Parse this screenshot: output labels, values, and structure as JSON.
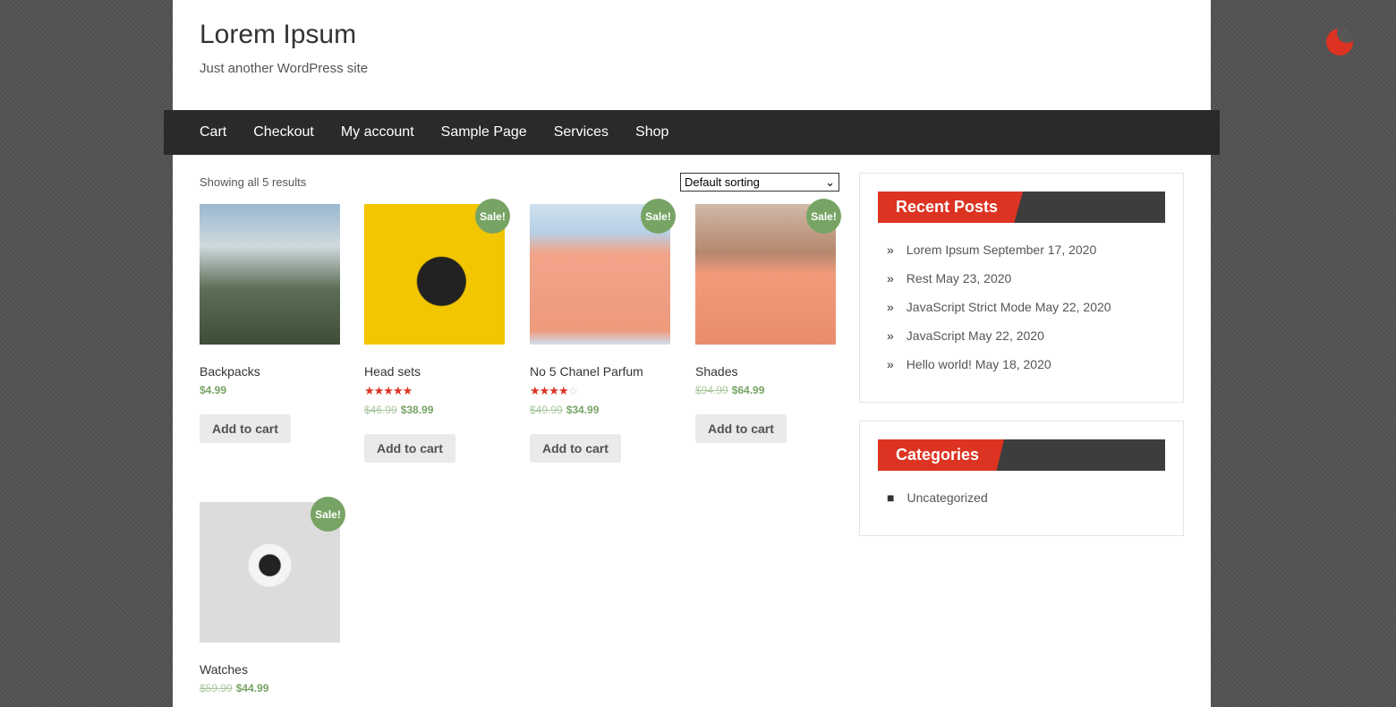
{
  "site": {
    "title": "Lorem Ipsum",
    "tagline": "Just another WordPress site"
  },
  "nav": [
    "Cart",
    "Checkout",
    "My account",
    "Sample Page",
    "Services",
    "Shop"
  ],
  "shop": {
    "result_count": "Showing all 5 results",
    "sorting": "Default sorting"
  },
  "products": [
    {
      "name": "Backpacks",
      "price": "$4.99",
      "old_price": "",
      "sale": "",
      "rating": null,
      "button": "Add to cart"
    },
    {
      "name": "Head sets",
      "price": "$38.99",
      "old_price": "$46.99",
      "sale": "Sale!",
      "rating": 5,
      "button": "Add to cart"
    },
    {
      "name": "No 5 Chanel Parfum",
      "price": "$34.99",
      "old_price": "$49.99",
      "sale": "Sale!",
      "rating": 4,
      "button": "Add to cart"
    },
    {
      "name": "Shades",
      "price": "$64.99",
      "old_price": "$94.99",
      "sale": "Sale!",
      "rating": null,
      "button": "Add to cart"
    },
    {
      "name": "Watches",
      "price": "$44.99",
      "old_price": "$59.99",
      "sale": "Sale!",
      "rating": null,
      "button": ""
    }
  ],
  "sidebar": {
    "recent_posts": {
      "title": "Recent Posts",
      "items": [
        "Lorem Ipsum September 17, 2020",
        "Rest May 23, 2020",
        "JavaScript Strict Mode May 22, 2020",
        "JavaScript May 22, 2020",
        "Hello world! May 18, 2020"
      ]
    },
    "categories": {
      "title": "Categories",
      "items": [
        "Uncategorized"
      ]
    }
  },
  "colors": {
    "accent": "#dd3322",
    "sale": "#77a464",
    "nav": "#2a2a2a"
  }
}
